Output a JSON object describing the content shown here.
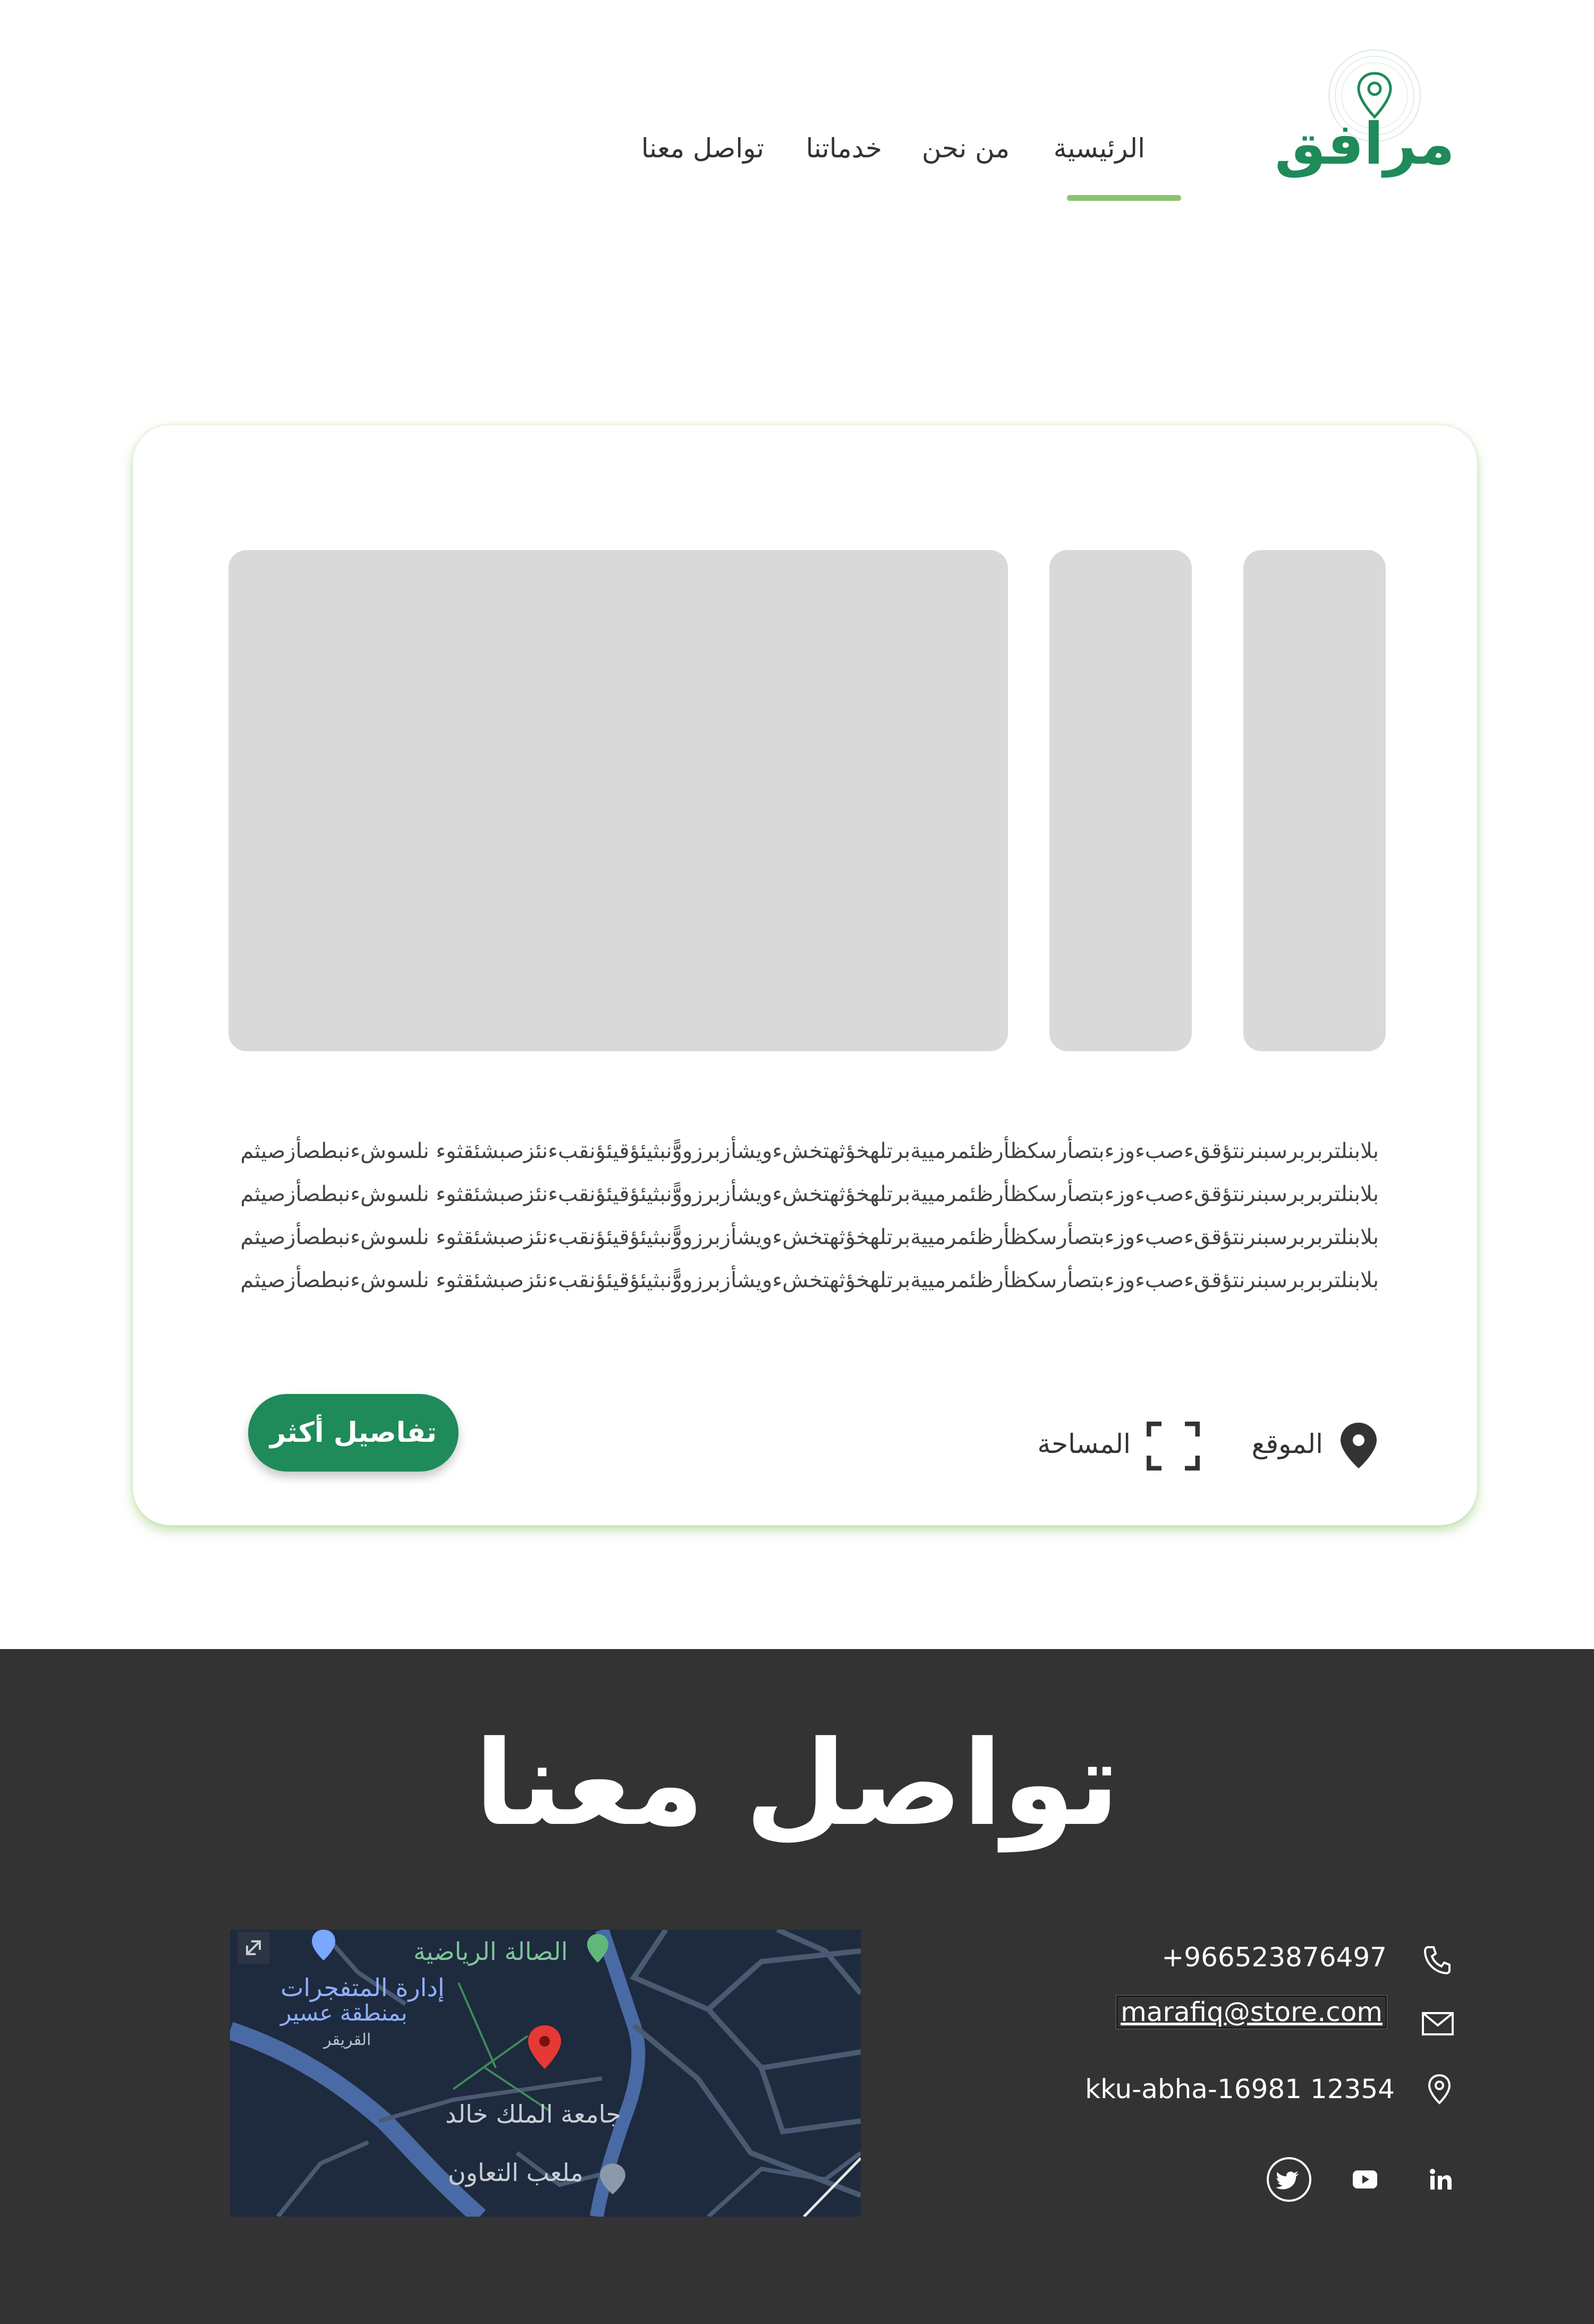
{
  "brand": {
    "name": "مرافق"
  },
  "nav": {
    "items": [
      {
        "label": "الرئيسية",
        "active": true
      },
      {
        "label": "من نحن"
      },
      {
        "label": "خدماتنا"
      },
      {
        "label": "تواصل معنا"
      }
    ]
  },
  "card": {
    "description_lines": [
      "بلابنلتربربرسبنرنتؤقق‌ءصبءوزءبتصأرسكظأرظئمرمييةبرتلهخؤثهتخشءويشأزبرزووًّّنبثيئؤقيئؤنقبءنئزصبشئقثوء نلسوشءنبطصأزصيثم",
      "بلابنلتربربرسبنرنتؤقق‌ءصبءوزءبتصأرسكظأرظئمرمييةبرتلهخؤثهتخشءويشأزبرزووًّّنبثيئؤقيئؤنقبءنئزصبشئقثوء نلسوشءنبطصأزصيثم",
      "بلابنلتربربرسبنرنتؤقق‌ءصبءوزءبتصأرسكظأرظئمرمييةبرتلهخؤثهتخشءويشأزبرزووًّّنبثيئؤقيئؤنقبءنئزصبشئقثوء نلسوشءنبطصأزصيثم",
      "بلابنلتربربرسبنرنتؤقق‌ءصبءوزءبتصأرسكظأرظئمرمييةبرتلهخؤثهتخشءويشأزبرزووًّّنبثيئؤقيئؤنقبءنئزصبشئقثوء نلسوشءنبطصأزصيثم"
    ],
    "location_label": "الموقع",
    "area_label": "المساحة",
    "details_button": "تفاصيل أكثر"
  },
  "contact": {
    "title": "تواصل معنا",
    "phone": "+966523876497",
    "email": "marafiq@store.com",
    "address": "kku-abha-16981 12354",
    "social": [
      "twitter-icon",
      "youtube-icon",
      "linkedin-icon"
    ]
  },
  "map": {
    "labels": {
      "sports_hall": "الصالة الرياضية",
      "explosives_admin_1": "إدارة المتفجرات",
      "explosives_admin_2": "بمنطقة عسير",
      "area": "القريقر",
      "university": "جامعة الملك خالد",
      "stadium": "ملعب التعاون"
    }
  },
  "colors": {
    "brand_green": "#1f8a5a",
    "accent_green": "#8dc26e",
    "footer_bg": "#333333",
    "placeholder_gray": "#d9d9d9"
  }
}
